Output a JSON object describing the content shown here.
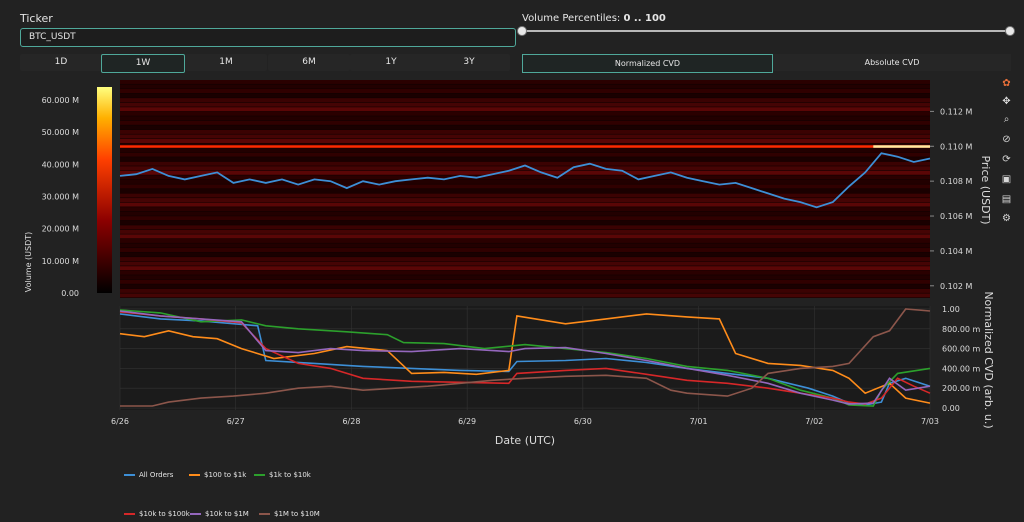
{
  "ticker": {
    "label": "Ticker",
    "value": "BTC_USDT"
  },
  "volume_percentiles": {
    "label": "Volume Percentiles:",
    "range": "0 .. 100",
    "low": 0,
    "high": 100
  },
  "timeframes": [
    {
      "label": "1D",
      "active": false
    },
    {
      "label": "1W",
      "active": true
    },
    {
      "label": "1M",
      "active": false
    },
    {
      "label": "6M",
      "active": false
    },
    {
      "label": "1Y",
      "active": false
    },
    {
      "label": "3Y",
      "active": false
    }
  ],
  "cvd_modes": [
    {
      "label": "Normalized CVD",
      "active": true
    },
    {
      "label": "Absolute CVD",
      "active": false
    }
  ],
  "toolbar": [
    "plotly-logo-icon",
    "pan-icon",
    "zoom-icon",
    "lasso-icon",
    "reset-icon",
    "camera-icon",
    "comment-icon",
    "settings-icon"
  ],
  "chart_data": [
    {
      "type": "heatmap",
      "title": "",
      "colorbar": {
        "label": "Volume (USDT)",
        "ticks": [
          "60.000 M",
          "50.000 M",
          "40.000 M",
          "30.000 M",
          "20.000 M",
          "10.000 M",
          "0.00"
        ],
        "range": [
          0,
          64
        ],
        "colors": [
          "#000000",
          "#8b0000",
          "#ff4000",
          "#ffb000",
          "#ffff80"
        ]
      },
      "ylabel": "Price (USDT)",
      "y_ticks": [
        "0.112 M",
        "0.110 M",
        "0.108 M",
        "0.106 M",
        "0.104 M",
        "0.102 M"
      ],
      "ylim": [
        0.1013,
        0.1138
      ],
      "price_series_color": "#3d8fd6",
      "price_series": [
        [
          0,
          0.1083
        ],
        [
          0.02,
          0.1084
        ],
        [
          0.04,
          0.1087
        ],
        [
          0.06,
          0.1083
        ],
        [
          0.08,
          0.1081
        ],
        [
          0.1,
          0.1083
        ],
        [
          0.12,
          0.1085
        ],
        [
          0.14,
          0.1079
        ],
        [
          0.16,
          0.1081
        ],
        [
          0.18,
          0.1079
        ],
        [
          0.2,
          0.1081
        ],
        [
          0.22,
          0.1078
        ],
        [
          0.24,
          0.1081
        ],
        [
          0.26,
          0.108
        ],
        [
          0.28,
          0.1076
        ],
        [
          0.3,
          0.108
        ],
        [
          0.32,
          0.1078
        ],
        [
          0.34,
          0.108
        ],
        [
          0.36,
          0.1081
        ],
        [
          0.38,
          0.1082
        ],
        [
          0.4,
          0.1081
        ],
        [
          0.42,
          0.1083
        ],
        [
          0.44,
          0.1082
        ],
        [
          0.46,
          0.1084
        ],
        [
          0.48,
          0.1086
        ],
        [
          0.5,
          0.1089
        ],
        [
          0.52,
          0.1085
        ],
        [
          0.54,
          0.1082
        ],
        [
          0.56,
          0.1088
        ],
        [
          0.58,
          0.109
        ],
        [
          0.6,
          0.1087
        ],
        [
          0.62,
          0.1086
        ],
        [
          0.64,
          0.1081
        ],
        [
          0.66,
          0.1083
        ],
        [
          0.68,
          0.1085
        ],
        [
          0.7,
          0.1082
        ],
        [
          0.72,
          0.108
        ],
        [
          0.74,
          0.1078
        ],
        [
          0.76,
          0.1079
        ],
        [
          0.78,
          0.1076
        ],
        [
          0.8,
          0.1073
        ],
        [
          0.82,
          0.107
        ],
        [
          0.84,
          0.1068
        ],
        [
          0.86,
          0.1065
        ],
        [
          0.88,
          0.1068
        ],
        [
          0.9,
          0.1077
        ],
        [
          0.92,
          0.1085
        ],
        [
          0.94,
          0.1096
        ],
        [
          0.96,
          0.1094
        ],
        [
          0.98,
          0.1091
        ],
        [
          1,
          0.1093
        ]
      ],
      "bright_level": {
        "price": 0.11,
        "bright_from": 0.93
      }
    },
    {
      "type": "line",
      "title": "",
      "xlabel": "Date (UTC)",
      "ylabel": "Normalized CVD (arb. u.)",
      "x_ticks": [
        "6/26",
        "6/27",
        "6/28",
        "6/29",
        "6/30",
        "7/01",
        "7/02",
        "7/03"
      ],
      "y_ticks": [
        "1.00",
        "800.00 m",
        "600.00 m",
        "400.00 m",
        "200.00 m",
        "0.00"
      ],
      "ylim": [
        -0.02,
        1.03
      ],
      "series": [
        {
          "name": "All Orders",
          "color": "#3d8fd6",
          "values": [
            [
              0,
              0.95
            ],
            [
              0.05,
              0.9
            ],
            [
              0.1,
              0.88
            ],
            [
              0.17,
              0.83
            ],
            [
              0.18,
              0.48
            ],
            [
              0.24,
              0.45
            ],
            [
              0.3,
              0.42
            ],
            [
              0.36,
              0.4
            ],
            [
              0.42,
              0.38
            ],
            [
              0.48,
              0.37
            ],
            [
              0.49,
              0.47
            ],
            [
              0.55,
              0.48
            ],
            [
              0.6,
              0.5
            ],
            [
              0.65,
              0.46
            ],
            [
              0.7,
              0.4
            ],
            [
              0.75,
              0.35
            ],
            [
              0.8,
              0.3
            ],
            [
              0.85,
              0.2
            ],
            [
              0.88,
              0.12
            ],
            [
              0.9,
              0.05
            ],
            [
              0.92,
              0.03
            ],
            [
              0.94,
              0.06
            ],
            [
              0.95,
              0.25
            ],
            [
              0.97,
              0.3
            ],
            [
              1,
              0.22
            ]
          ]
        },
        {
          "name": "$100 to $1k",
          "color": "#ff8c1a",
          "values": [
            [
              0,
              0.75
            ],
            [
              0.03,
              0.72
            ],
            [
              0.06,
              0.78
            ],
            [
              0.09,
              0.72
            ],
            [
              0.12,
              0.7
            ],
            [
              0.15,
              0.6
            ],
            [
              0.19,
              0.5
            ],
            [
              0.24,
              0.55
            ],
            [
              0.28,
              0.62
            ],
            [
              0.33,
              0.58
            ],
            [
              0.36,
              0.35
            ],
            [
              0.4,
              0.36
            ],
            [
              0.44,
              0.34
            ],
            [
              0.48,
              0.38
            ],
            [
              0.49,
              0.93
            ],
            [
              0.55,
              0.85
            ],
            [
              0.6,
              0.9
            ],
            [
              0.65,
              0.95
            ],
            [
              0.7,
              0.92
            ],
            [
              0.74,
              0.9
            ],
            [
              0.76,
              0.55
            ],
            [
              0.8,
              0.45
            ],
            [
              0.84,
              0.43
            ],
            [
              0.88,
              0.38
            ],
            [
              0.9,
              0.3
            ],
            [
              0.92,
              0.15
            ],
            [
              0.95,
              0.25
            ],
            [
              0.97,
              0.1
            ],
            [
              1,
              0.05
            ]
          ]
        },
        {
          "name": "$1k to $10k",
          "color": "#2ca02c",
          "values": [
            [
              0,
              0.99
            ],
            [
              0.05,
              0.96
            ],
            [
              0.1,
              0.87
            ],
            [
              0.15,
              0.89
            ],
            [
              0.18,
              0.83
            ],
            [
              0.22,
              0.8
            ],
            [
              0.28,
              0.77
            ],
            [
              0.33,
              0.74
            ],
            [
              0.35,
              0.66
            ],
            [
              0.4,
              0.65
            ],
            [
              0.45,
              0.6
            ],
            [
              0.5,
              0.64
            ],
            [
              0.55,
              0.6
            ],
            [
              0.6,
              0.56
            ],
            [
              0.65,
              0.5
            ],
            [
              0.7,
              0.42
            ],
            [
              0.75,
              0.38
            ],
            [
              0.8,
              0.3
            ],
            [
              0.84,
              0.18
            ],
            [
              0.88,
              0.1
            ],
            [
              0.9,
              0.03
            ],
            [
              0.93,
              0.02
            ],
            [
              0.94,
              0.18
            ],
            [
              0.96,
              0.35
            ],
            [
              1,
              0.4
            ]
          ]
        },
        {
          "name": "$10k to $100k",
          "color": "#d62728",
          "values": [
            [
              0,
              0.97
            ],
            [
              0.05,
              0.93
            ],
            [
              0.1,
              0.9
            ],
            [
              0.15,
              0.86
            ],
            [
              0.18,
              0.6
            ],
            [
              0.22,
              0.45
            ],
            [
              0.26,
              0.4
            ],
            [
              0.3,
              0.3
            ],
            [
              0.36,
              0.27
            ],
            [
              0.42,
              0.26
            ],
            [
              0.48,
              0.25
            ],
            [
              0.49,
              0.35
            ],
            [
              0.55,
              0.38
            ],
            [
              0.6,
              0.4
            ],
            [
              0.65,
              0.34
            ],
            [
              0.7,
              0.28
            ],
            [
              0.75,
              0.25
            ],
            [
              0.8,
              0.2
            ],
            [
              0.84,
              0.15
            ],
            [
              0.88,
              0.1
            ],
            [
              0.9,
              0.06
            ],
            [
              0.92,
              0.04
            ],
            [
              0.94,
              0.1
            ],
            [
              0.96,
              0.3
            ],
            [
              0.98,
              0.22
            ],
            [
              1,
              0.15
            ]
          ]
        },
        {
          "name": "$10k to $1M",
          "color": "#9467bd",
          "values": [
            [
              0,
              0.98
            ],
            [
              0.05,
              0.93
            ],
            [
              0.1,
              0.9
            ],
            [
              0.15,
              0.87
            ],
            [
              0.18,
              0.58
            ],
            [
              0.22,
              0.56
            ],
            [
              0.26,
              0.6
            ],
            [
              0.3,
              0.58
            ],
            [
              0.36,
              0.57
            ],
            [
              0.42,
              0.6
            ],
            [
              0.48,
              0.57
            ],
            [
              0.5,
              0.6
            ],
            [
              0.55,
              0.61
            ],
            [
              0.6,
              0.55
            ],
            [
              0.65,
              0.48
            ],
            [
              0.7,
              0.4
            ],
            [
              0.75,
              0.33
            ],
            [
              0.8,
              0.25
            ],
            [
              0.84,
              0.15
            ],
            [
              0.88,
              0.08
            ],
            [
              0.9,
              0.04
            ],
            [
              0.93,
              0.05
            ],
            [
              0.95,
              0.3
            ],
            [
              0.97,
              0.18
            ],
            [
              1,
              0.22
            ]
          ]
        },
        {
          "name": "$1M to $10M",
          "color": "#8c564b",
          "values": [
            [
              0,
              0.02
            ],
            [
              0.04,
              0.02
            ],
            [
              0.06,
              0.06
            ],
            [
              0.1,
              0.1
            ],
            [
              0.14,
              0.12
            ],
            [
              0.18,
              0.15
            ],
            [
              0.22,
              0.2
            ],
            [
              0.26,
              0.22
            ],
            [
              0.3,
              0.18
            ],
            [
              0.34,
              0.2
            ],
            [
              0.38,
              0.22
            ],
            [
              0.42,
              0.25
            ],
            [
              0.46,
              0.28
            ],
            [
              0.5,
              0.3
            ],
            [
              0.55,
              0.32
            ],
            [
              0.6,
              0.33
            ],
            [
              0.65,
              0.3
            ],
            [
              0.68,
              0.18
            ],
            [
              0.7,
              0.15
            ],
            [
              0.75,
              0.12
            ],
            [
              0.78,
              0.2
            ],
            [
              0.8,
              0.35
            ],
            [
              0.84,
              0.4
            ],
            [
              0.88,
              0.42
            ],
            [
              0.9,
              0.45
            ],
            [
              0.93,
              0.72
            ],
            [
              0.95,
              0.78
            ],
            [
              0.97,
              1.0
            ],
            [
              1,
              0.98
            ]
          ]
        }
      ]
    }
  ]
}
